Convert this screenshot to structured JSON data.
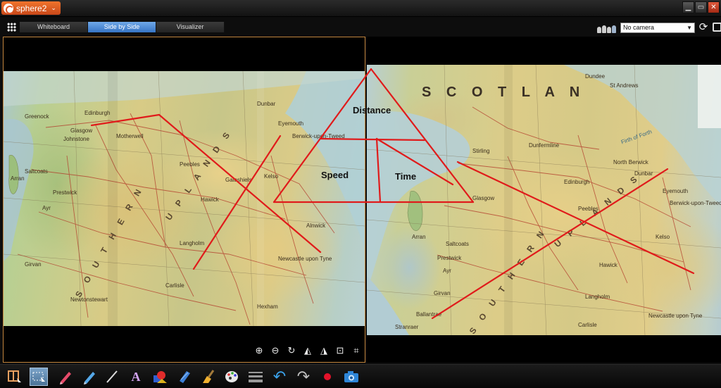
{
  "app": {
    "title": "sphere2",
    "menu_caret": "⌄"
  },
  "window_controls": {
    "minimize": "▁",
    "maximize": "▭",
    "close": "✕"
  },
  "tabs": [
    {
      "label": "Whiteboard",
      "active": false
    },
    {
      "label": "Side by Side",
      "active": true
    },
    {
      "label": "Visualizer",
      "active": false
    }
  ],
  "camera": {
    "selected": "No camera",
    "dropdown_arrow": "▼"
  },
  "annotations": {
    "distance": "Distance",
    "speed": "Speed",
    "time": "Time"
  },
  "left_map": {
    "labels": [
      "Edinburgh",
      "Glasgow",
      "Greenock",
      "Johnstone",
      "Motherwell",
      "Peebles",
      "Dunbar",
      "Eyemouth",
      "Berwick-upon-Tweed",
      "Kelso",
      "Hawick",
      "Langholm",
      "Ayr",
      "Prestwick",
      "Girvan",
      "Newtonstewart",
      "Newcastle upon Tyne",
      "Alnwick",
      "Hexham",
      "Carlisle",
      "Arran",
      "Saltcoats",
      "Galashiels"
    ],
    "regions": [
      "S O U T H E R N",
      "U P L A N D S"
    ]
  },
  "right_map": {
    "labels": [
      "Edinburgh",
      "Glasgow",
      "Stirling",
      "Dunfermline",
      "Dundee",
      "St Andrews",
      "North Berwick",
      "Dunbar",
      "Eyemouth",
      "Berwick-upon-Tweed",
      "Peebles",
      "Kelso",
      "Hawick",
      "Langholm",
      "Prestwick",
      "Ayr",
      "Girvan",
      "Ballantrae",
      "Stranraer",
      "Newcastle upon Tyne",
      "Carlisle",
      "Arran",
      "Saltcoats",
      "Firth of Forth"
    ],
    "country": "S C O T L A N",
    "regions": [
      "S O U T H E R N",
      "U P L A N D S"
    ]
  },
  "view_tools": [
    "zoom-in-icon",
    "zoom-out-icon",
    "rotate-icon",
    "flip-horizontal-icon",
    "flip-vertical-icon",
    "fit-icon",
    "crop-icon"
  ],
  "bottom_tools": [
    "layout-icon",
    "select-icon",
    "red-pen-icon",
    "blue-pen-icon",
    "line-icon",
    "text-icon",
    "shapes-icon",
    "highlighter-icon",
    "eraser-icon",
    "palette-icon",
    "line-width-icon",
    "undo-icon",
    "redo-icon",
    "record-icon",
    "camera-icon"
  ],
  "colors": {
    "accent": "#3674c4",
    "panel_border": "#c2843c",
    "app_badge": "#e0582a",
    "annotation_red": "#e01b1b"
  }
}
